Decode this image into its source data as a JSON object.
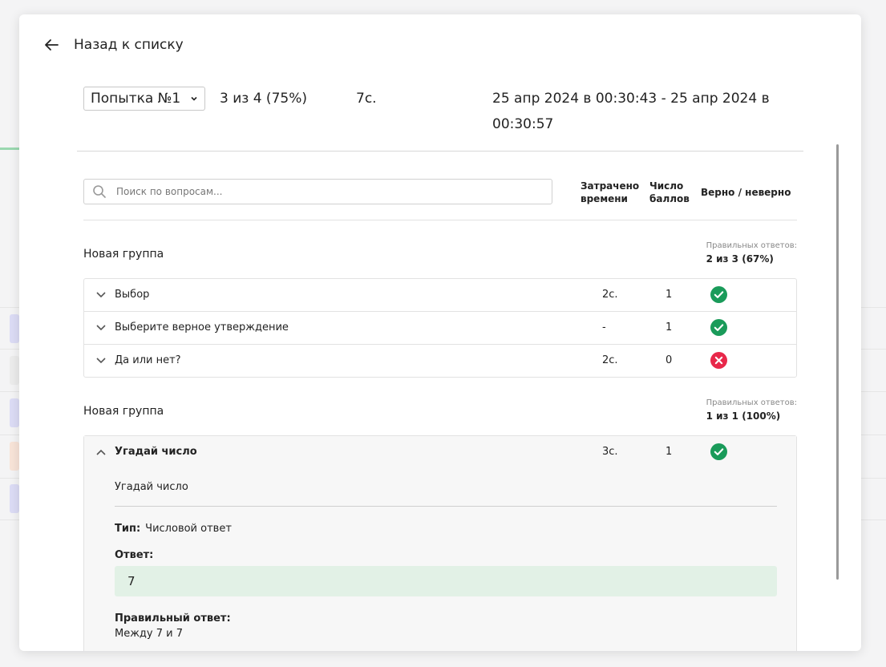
{
  "header": {
    "back_label": "Назад к списку"
  },
  "attempt": {
    "selected": "Попытка №1",
    "score": "3 из 4 (75%)",
    "duration": "7с.",
    "range": "25 апр 2024 в 00:30:43 - 25 апр 2024 в 00:30:57"
  },
  "search": {
    "placeholder": "Поиск по вопросам..."
  },
  "columns": {
    "time_l1": "Затрачено",
    "time_l2": "времени",
    "points_l1": "Число",
    "points_l2": "баллов",
    "result": "Верно / неверно"
  },
  "groups": [
    {
      "title": "Новая группа",
      "correct_label": "Правильных ответов:",
      "correct_value": "2 из 3 (67%)",
      "questions": [
        {
          "title": "Выбор",
          "time": "2с.",
          "points": "1",
          "result": "correct"
        },
        {
          "title": "Выберите верное утверждение",
          "time": "-",
          "points": "1",
          "result": "correct"
        },
        {
          "title": "Да или нет?",
          "time": "2с.",
          "points": "0",
          "result": "wrong"
        }
      ]
    },
    {
      "title": "Новая группа",
      "correct_label": "Правильных ответов:",
      "correct_value": "1 из 1 (100%)",
      "questions": [
        {
          "title": "Угадай число",
          "time": "3с.",
          "points": "1",
          "result": "correct",
          "expanded": true,
          "question_text": "Угадай число",
          "type_label": "Тип:",
          "type_value": "Числовой ответ",
          "answer_label": "Ответ:",
          "answer_value": "7",
          "correct_answer_label": "Правильный ответ:",
          "correct_answer_value": "Между 7 и 7"
        }
      ]
    }
  ],
  "colors": {
    "correct": "#1a9b5a",
    "wrong": "#e8284a",
    "answer_bg": "#e2f1e6"
  }
}
